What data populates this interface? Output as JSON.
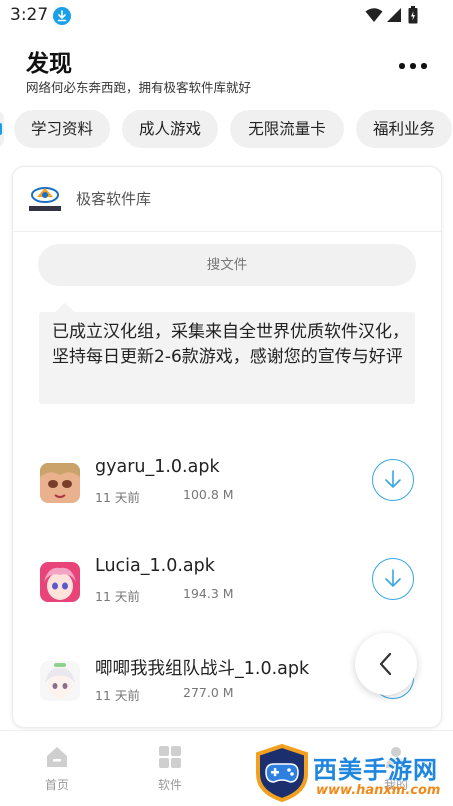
{
  "status_bar": {
    "time": "3:27"
  },
  "header": {
    "title": "发现",
    "subtitle": "网络何必东奔西跑，拥有极客软件库就好"
  },
  "chips": [
    "学习资料",
    "成人游戏",
    "无限流量卡",
    "福利业务"
  ],
  "card": {
    "name": "极客软件库",
    "search_placeholder": "搜文件",
    "notice": "已成立汉化组，采集来自全世界优质软件汉化，坚持每日更新2-6款游戏，感谢您的宣传与好评",
    "files": [
      {
        "name": "gyaru_1.0.apk",
        "date": "11 天前",
        "size": "100.8 M"
      },
      {
        "name": "Lucia_1.0.apk",
        "date": "11 天前",
        "size": "194.3 M"
      },
      {
        "name": "唧唧我我组队战斗_1.0.apk",
        "date": "11 天前",
        "size": "277.0 M"
      }
    ]
  },
  "bottom_nav": [
    {
      "label": "首页",
      "icon": "home-icon"
    },
    {
      "label": "软件",
      "icon": "grid-icon"
    },
    {
      "label": "我的",
      "icon": "user-icon"
    }
  ],
  "watermark": {
    "title": "西美手游网",
    "url": "www.hanxm.com"
  },
  "colors": {
    "accent": "#1aa0e8",
    "download_ring": "#39a7e3",
    "watermark_orange": "#f08a1c"
  }
}
